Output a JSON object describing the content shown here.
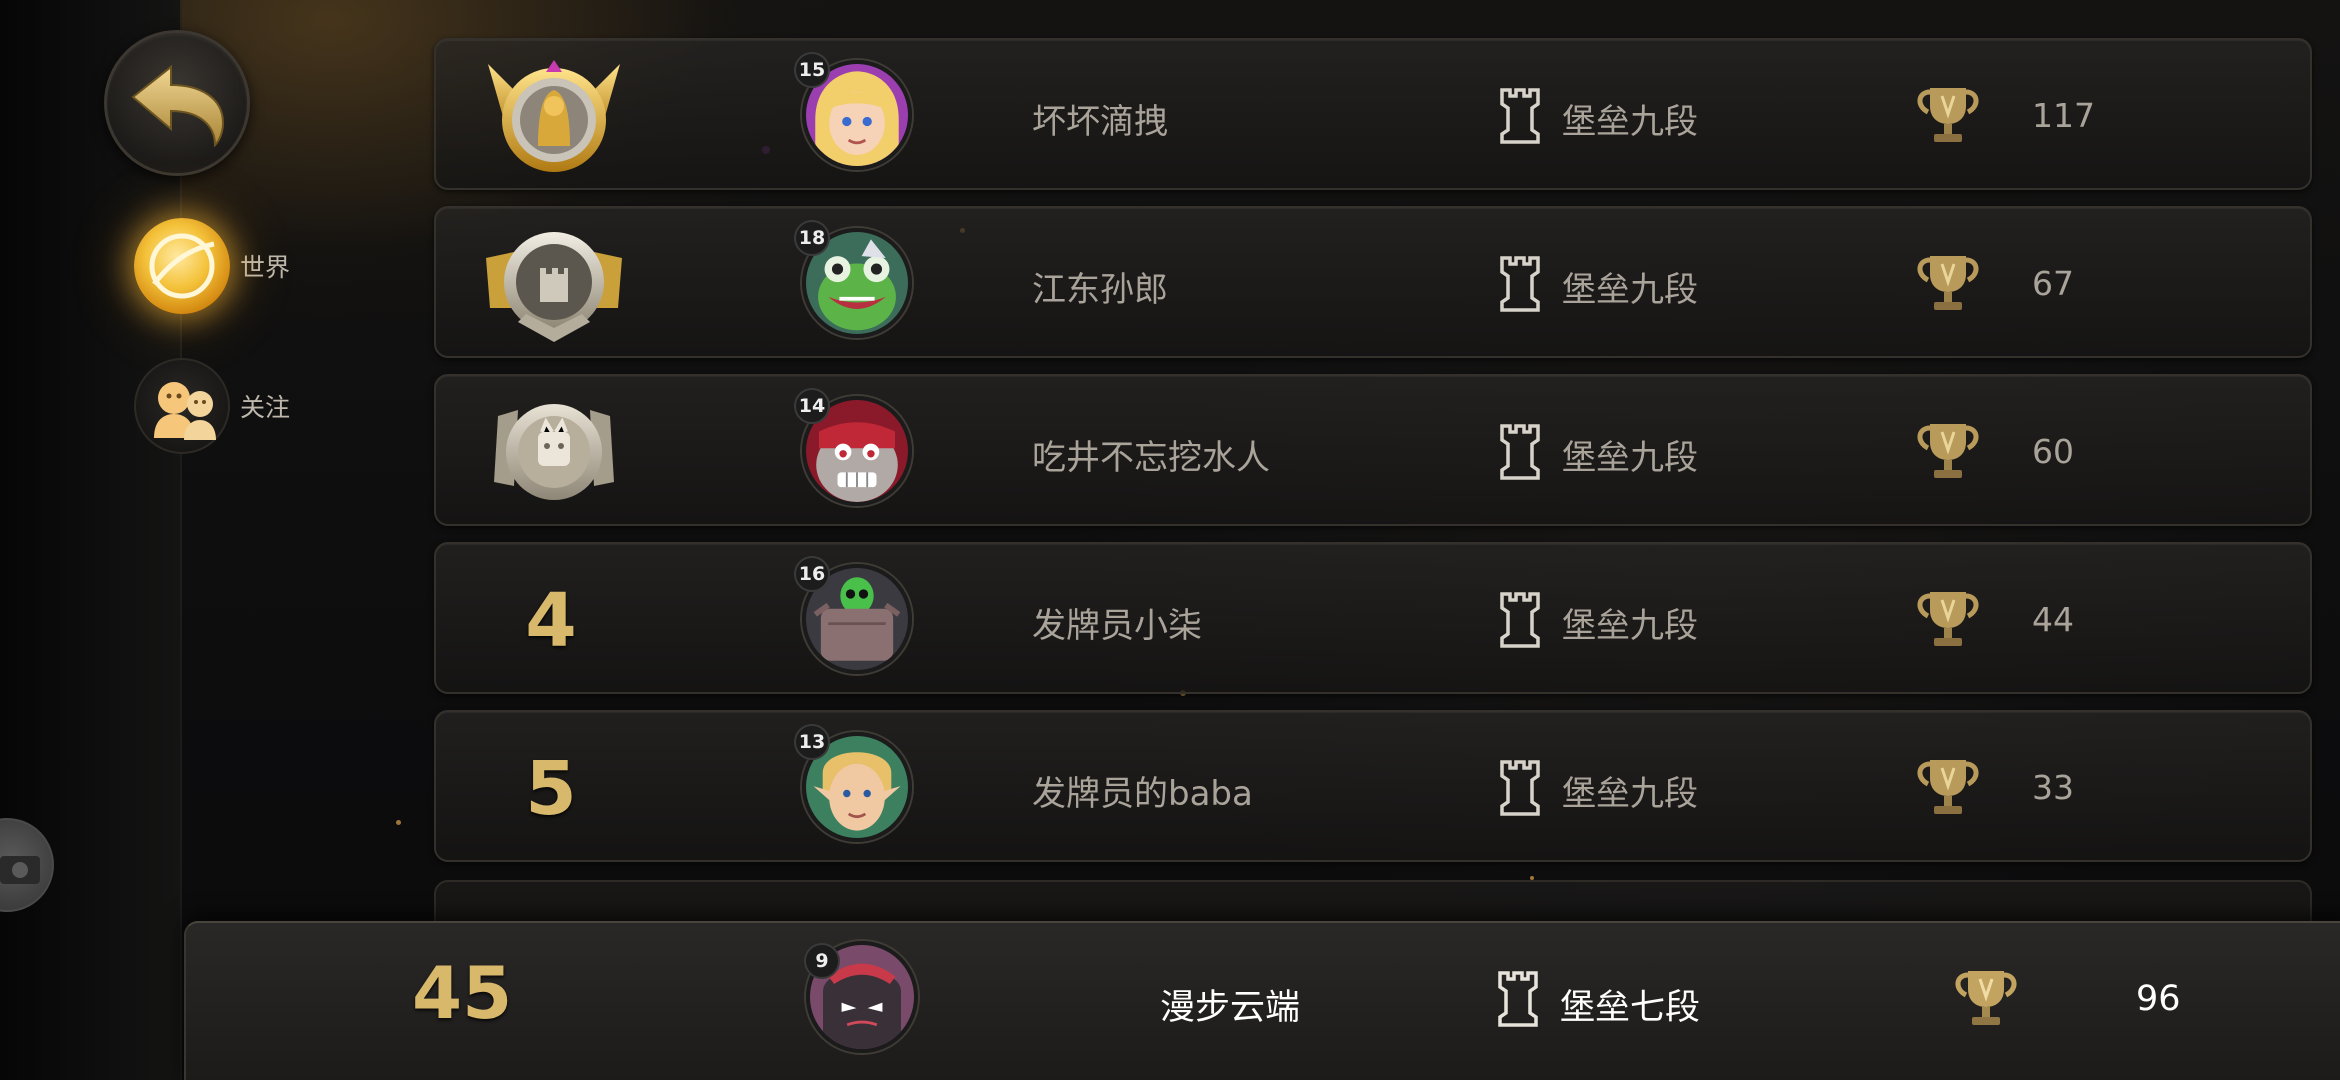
{
  "sidebar": {
    "tabs": [
      {
        "label": "世界",
        "icon": "world-planet-icon",
        "selected": true
      },
      {
        "label": "关注",
        "icon": "friends-icon",
        "selected": false
      }
    ]
  },
  "leaderboard": {
    "rows": [
      {
        "rank": "1",
        "badge": "gold-rank-badge-icon",
        "level": "15",
        "name": "坏坏滴拽",
        "tier": "堡垒九段",
        "score": "117"
      },
      {
        "rank": "2",
        "badge": "silver-rank-badge-icon",
        "level": "18",
        "name": "江东孙郎",
        "tier": "堡垒九段",
        "score": "67"
      },
      {
        "rank": "3",
        "badge": "bronze-rank-badge-icon",
        "level": "14",
        "name": "吃井不忘挖水人",
        "tier": "堡垒九段",
        "score": "60"
      },
      {
        "rank": "4",
        "level": "16",
        "name": "发牌员小柒",
        "tier": "堡垒九段",
        "score": "44"
      },
      {
        "rank": "5",
        "level": "13",
        "name": "发牌员的baba",
        "tier": "堡垒九段",
        "score": "33"
      }
    ]
  },
  "self": {
    "rank": "45",
    "level": "9",
    "name": "漫步云端",
    "tier": "堡垒七段",
    "score": "96"
  },
  "colors": {
    "gold_text": "#d8b96c",
    "row_text": "#a9a39a",
    "self_text": "#ffffff",
    "accent_glow": "#f4c23a"
  }
}
